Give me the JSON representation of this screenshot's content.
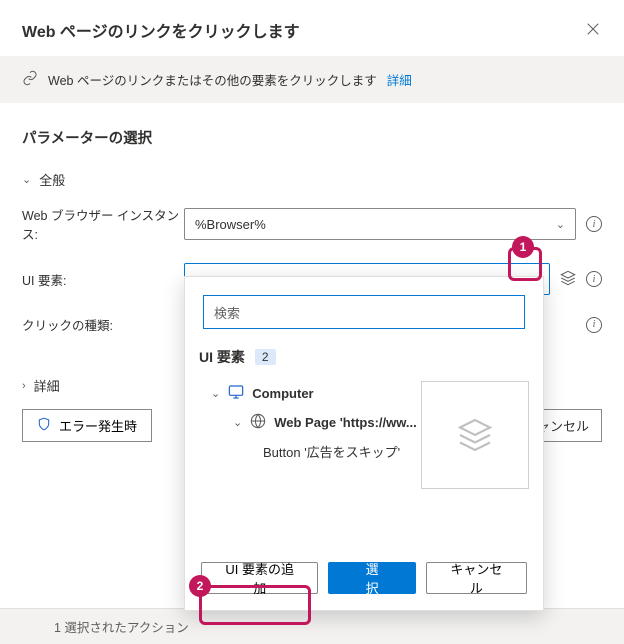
{
  "dialog": {
    "title": "Web ページのリンクをクリックします",
    "infoText": "Web ページのリンクまたはその他の要素をクリックします",
    "infoLink": "詳細",
    "paramsHeader": "パラメーターの選択"
  },
  "sections": {
    "general": "全般",
    "detail": "詳細"
  },
  "fields": {
    "browserInstance": {
      "label": "Web ブラウザー インスタンス:",
      "value": "%Browser%"
    },
    "uiElement": {
      "label": "UI 要素:"
    },
    "clickType": {
      "label": "クリックの種類:"
    }
  },
  "popup": {
    "searchPlaceholder": "検索",
    "header": "UI 要素",
    "count": "2",
    "tree": {
      "root": "Computer",
      "page": "Web Page 'https://ww...",
      "item": "Button '広告をスキップ'"
    },
    "addButton": "UI 要素の追加",
    "selectButton": "選択",
    "cancelButton": "キャンセル"
  },
  "errorButton": "エラー発生時",
  "mainCancelFragment": "ャンセル",
  "status": "1 選択されたアクション",
  "markers": {
    "one": "1",
    "two": "2"
  }
}
